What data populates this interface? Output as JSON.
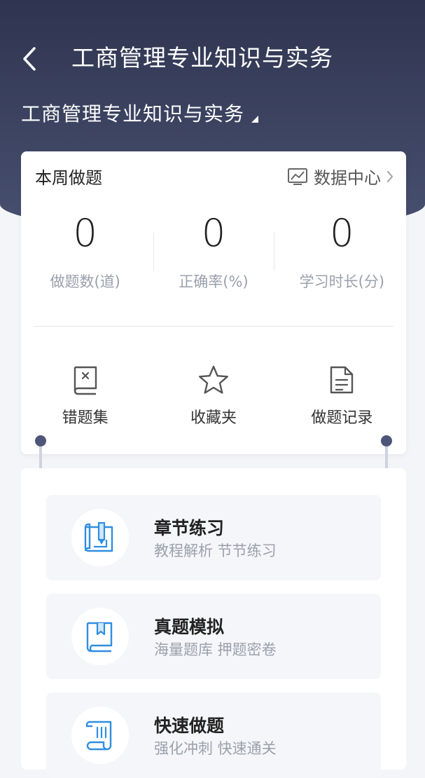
{
  "header": {
    "title": "工商管理专业知识与实务",
    "subject": "工商管理专业知识与实务"
  },
  "weekly": {
    "title": "本周做题",
    "data_center_label": "数据中心",
    "stats": [
      {
        "value": "0",
        "label": "做题数(道)"
      },
      {
        "value": "0",
        "label": "正确率(%)"
      },
      {
        "value": "0",
        "label": "学习时长(分)"
      }
    ],
    "quick_links": [
      {
        "label": "错题集",
        "icon": "wrong-book-icon"
      },
      {
        "label": "收藏夹",
        "icon": "star-icon"
      },
      {
        "label": "做题记录",
        "icon": "document-icon"
      }
    ]
  },
  "features": [
    {
      "title": "章节练习",
      "desc": "教程解析 节节练习",
      "icon": "blueprint-pencil-icon"
    },
    {
      "title": "真题模拟",
      "desc": "海量题库 押题密卷",
      "icon": "bookmark-book-icon"
    },
    {
      "title": "快速做题",
      "desc": "强化冲刺 快速通关",
      "icon": "scroll-icon"
    }
  ],
  "colors": {
    "header_bg": "#363d5a",
    "accent_blue": "#2f8ee0",
    "connector_dot": "#4d5578"
  }
}
